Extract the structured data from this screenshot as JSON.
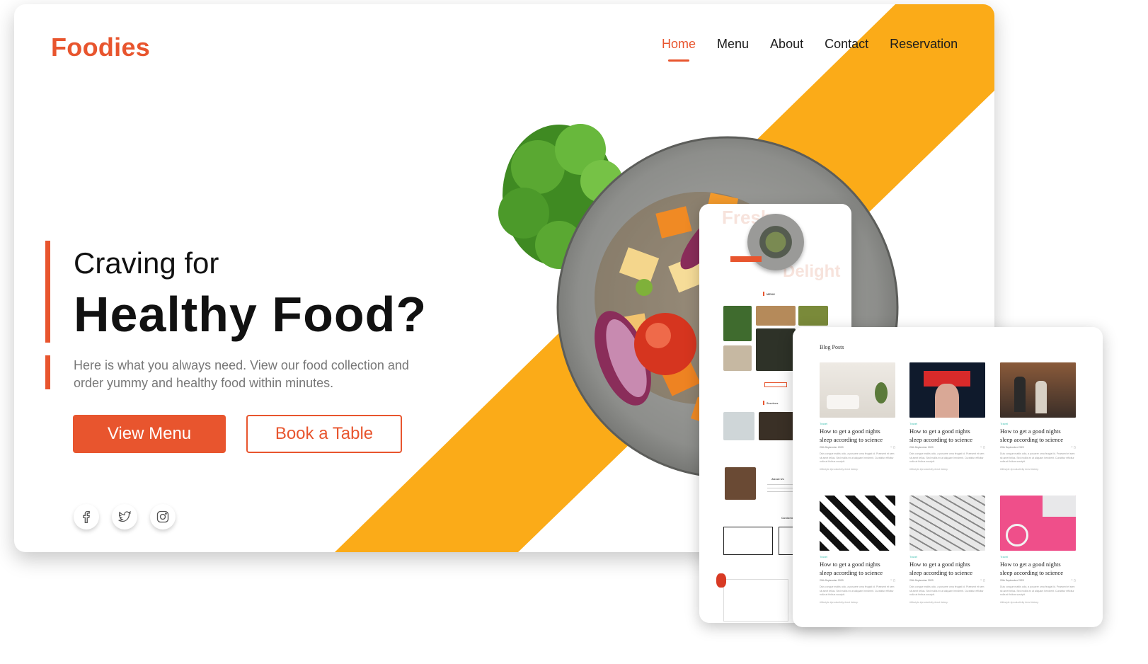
{
  "brand": {
    "name": "Foodies",
    "accent": "#e8552e",
    "stripe": "#fbab18"
  },
  "nav": {
    "items": [
      {
        "label": "Home",
        "active": true
      },
      {
        "label": "Menu",
        "active": false
      },
      {
        "label": "About",
        "active": false
      },
      {
        "label": "Contact",
        "active": false
      },
      {
        "label": "Reservation",
        "active": false
      }
    ]
  },
  "hero": {
    "kicker": "Craving for",
    "headline": "Healthy Food?",
    "description": "Here is what you always need. View our food collection and order yummy and healthy food within minutes.",
    "primary_button": "View Menu",
    "secondary_button": "Book a Table"
  },
  "social": [
    {
      "icon": "facebook-icon"
    },
    {
      "icon": "twitter-icon"
    },
    {
      "icon": "instagram-icon"
    }
  ],
  "phone": {
    "ghost_top": "Fresh",
    "ghost_bottom": "Delight",
    "menu_heading": "MENU",
    "services_heading": "Services",
    "about_heading": "About Us",
    "customers_heading": "Customers",
    "table_heading": "Table"
  },
  "blog": {
    "title": "Blog Posts",
    "posts": [
      {
        "tag": "Travel",
        "title": "How to get a good nights sleep according to science",
        "date": "20th September 2020",
        "body": "Duis congue mattis odio, a posuere urna feugiat id. Praesent et sem sit amet tellus. Sed mollis ex at aliquam hendrerit. Curabitur efficitur nulla at finibus suscipit.",
        "tags": "#lifestyle  #productivity  #rest  #sleep"
      },
      {
        "tag": "Travel",
        "title": "How to get a good nights sleep according to science",
        "date": "20th September 2020",
        "body": "Duis congue mattis odio, a posuere urna feugiat id. Praesent et sem sit amet tellus. Sed mollis ex at aliquam hendrerit. Curabitur efficitur nulla at finibus suscipit.",
        "tags": "#lifestyle  #productivity  #rest  #sleep"
      },
      {
        "tag": "Travel",
        "title": "How to get a good nights sleep according to science",
        "date": "20th September 2020",
        "body": "Duis congue mattis odio, a posuere urna feugiat id. Praesent et sem sit amet tellus. Sed mollis ex at aliquam hendrerit. Curabitur efficitur nulla at finibus suscipit.",
        "tags": "#lifestyle  #productivity  #rest  #sleep"
      },
      {
        "tag": "Travel",
        "title": "How to get a good nights sleep according to science",
        "date": "20th September 2020",
        "body": "Duis congue mattis odio, a posuere urna feugiat id. Praesent et sem sit amet tellus. Sed mollis ex at aliquam hendrerit. Curabitur efficitur nulla at finibus suscipit.",
        "tags": "#lifestyle  #productivity  #rest  #sleep"
      },
      {
        "tag": "Travel",
        "title": "How to get a good nights sleep according to science",
        "date": "20th September 2020",
        "body": "Duis congue mattis odio, a posuere urna feugiat id. Praesent et sem sit amet tellus. Sed mollis ex at aliquam hendrerit. Curabitur efficitur nulla at finibus suscipit.",
        "tags": "#lifestyle  #productivity  #rest  #sleep"
      },
      {
        "tag": "Travel",
        "title": "How to get a good nights sleep according to science",
        "date": "20th September 2020",
        "body": "Duis congue mattis odio, a posuere urna feugiat id. Praesent et sem sit amet tellus. Sed mollis ex at aliquam hendrerit. Curabitur efficitur nulla at finibus suscipit.",
        "tags": "#lifestyle  #productivity  #rest  #sleep"
      }
    ]
  }
}
